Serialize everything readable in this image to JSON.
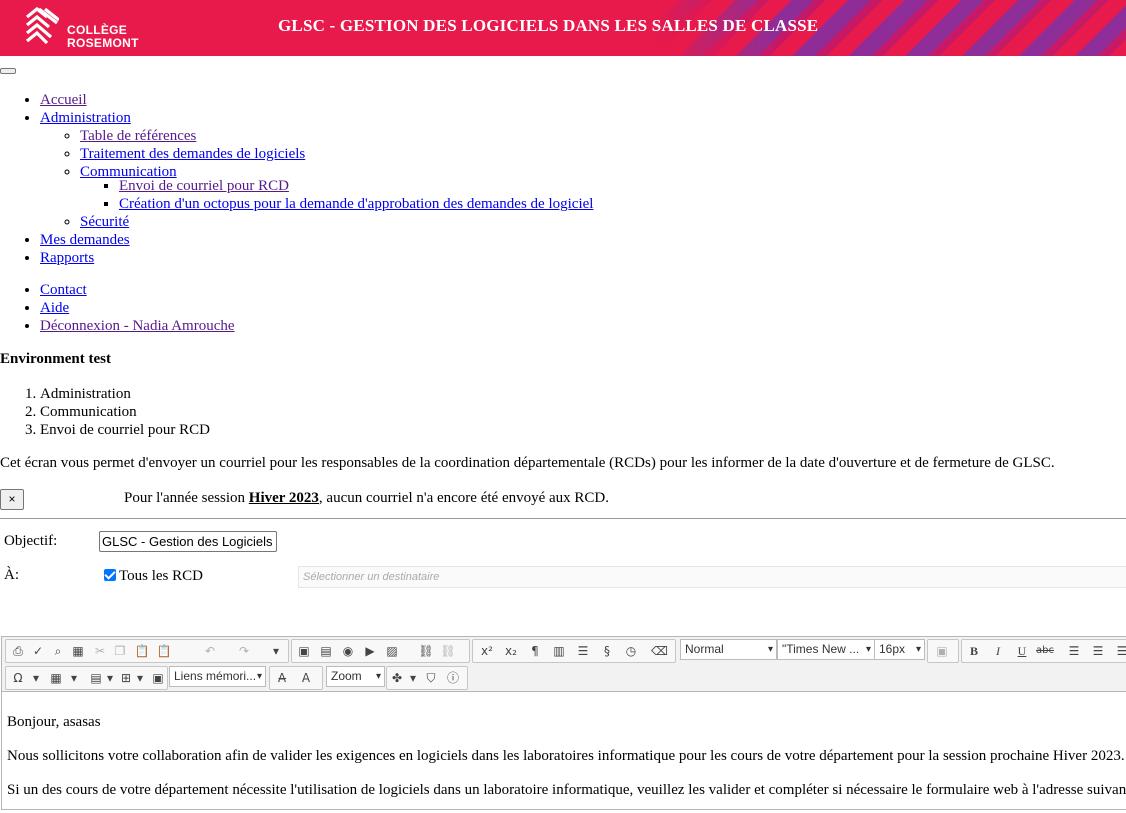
{
  "header": {
    "logo_line1": "COLLÈGE",
    "logo_line2": "ROSEMONT",
    "title": "GLSC - GESTION DES LOGICIELS DANS LES SALLES DE CLASSE"
  },
  "nav": {
    "accueil": "Accueil",
    "administration": "Administration",
    "table_references": "Table de références",
    "traitement": "Traitement des demandes de logiciels",
    "communication": "Communication",
    "envoi_courriel": "Envoi de courriel pour RCD",
    "creation_octopus": "Création d'un octopus pour la demande d'approbation des demandes de logiciel",
    "securite": "Sécurité",
    "mes_demandes": "Mes demandes",
    "rapports": "Rapports",
    "contact": "Contact",
    "aide": "Aide",
    "deconnexion": "Déconnexion - Nadia Amrouche"
  },
  "environment": "Environment test",
  "breadcrumb": [
    "Administration",
    "Communication",
    "Envoi de courriel pour RCD"
  ],
  "intro": "Cet écran vous permet d'envoyer un courriel pour les responsables de la coordination départementale (RCDs) pour les informer de la date d'ouverture et de fermeture de GLSC.",
  "alert": {
    "close": "×",
    "prefix": "Pour l'année session ",
    "session": "Hiver 2023",
    "suffix": ", aucun courriel n'a encore été envoyé aux RCD."
  },
  "form": {
    "objectif_label": "Objectif:",
    "objectif_value": "GLSC - Gestion des Logiciels dans les salles de classe",
    "a_label": "À:",
    "tous_rcd_label": "Tous les RCD",
    "tous_rcd_checked": true,
    "destinataire_placeholder": "Sélectionner un destinataire"
  },
  "editor": {
    "format_select": "Normal",
    "font_select": "\"Times New ...",
    "size_select": "16px",
    "links_select": "Liens mémori...",
    "zoom_select": "Zoom",
    "paragraphs": [
      "Bonjour, asasas",
      "Nous sollicitons votre collaboration afin de valider les exigences en logiciels dans les laboratoires informatique pour les cours de votre département pour la session prochaine Hiver 2023.",
      "Si un des cours de votre département nécessite l'utilisation de logiciels dans un laboratoire informatique, veuillez les valider et compléter si nécessaire le formulaire web à l'adresse suivante."
    ]
  },
  "colors": {
    "banner": "#e8194b",
    "accent_purple": "#8a2f9c",
    "link": "#0000ee",
    "checkbox": "#0075ff"
  }
}
